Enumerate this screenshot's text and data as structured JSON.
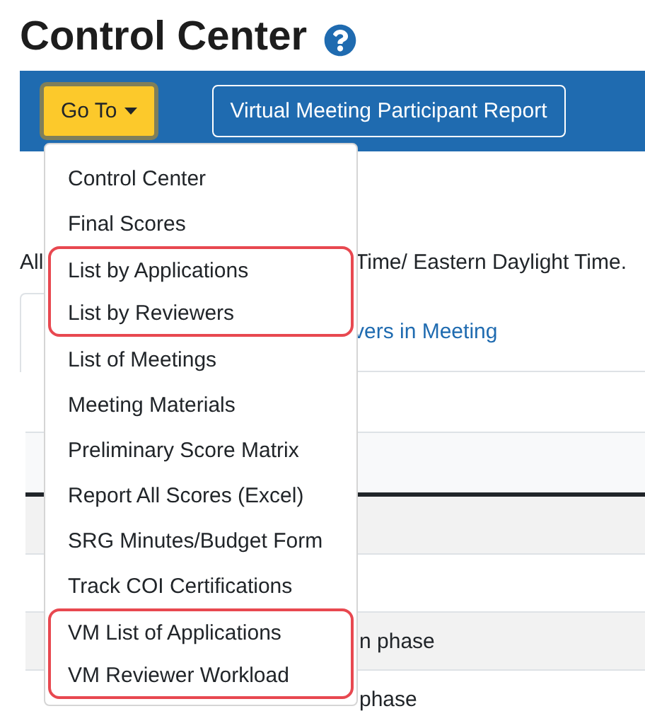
{
  "page_title": "Control Center",
  "toolbar": {
    "goto_button": {
      "label": "Go To",
      "expanded": true
    },
    "buttons": [
      "Virtual Meeting Participant Report"
    ]
  },
  "goto_menu": [
    {
      "label": "Control Center",
      "outlined": false
    },
    {
      "label": "Final Scores",
      "outlined": false
    },
    {
      "label": "List by Applications",
      "outlined": true
    },
    {
      "label": "List by Reviewers",
      "outlined": true
    },
    {
      "label": "List of Meetings",
      "outlined": false
    },
    {
      "label": "Meeting Materials",
      "outlined": false
    },
    {
      "label": "Preliminary Score Matrix",
      "outlined": false
    },
    {
      "label": "Report All Scores (Excel)",
      "outlined": false
    },
    {
      "label": "SRG Minutes/Budget Form",
      "outlined": false
    },
    {
      "label": "Track COI Certifications",
      "outlined": false
    },
    {
      "label": "VM List of Applications",
      "outlined": true
    },
    {
      "label": "VM Reviewer Workload",
      "outlined": true
    }
  ],
  "notice": [
    "All",
    "Time/ Eastern Daylight Time."
  ],
  "tabs": [
    {
      "label": "vers in Meeting",
      "selected": false
    }
  ],
  "table": {
    "rows": [
      {},
      {},
      {
        "column_2": "n phase"
      },
      {
        "column_2": "phase"
      }
    ]
  }
}
